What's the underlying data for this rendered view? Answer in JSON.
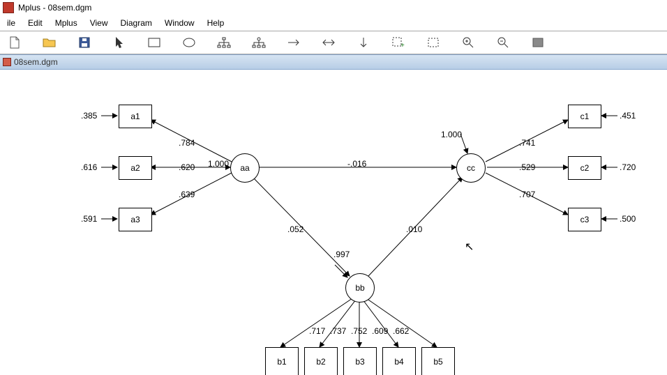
{
  "window": {
    "title": "Mplus - 08sem.dgm"
  },
  "menu": {
    "file": "ile",
    "edit": "Edit",
    "mplus": "Mplus",
    "view": "View",
    "diagram": "Diagram",
    "window": "Window",
    "help": "Help"
  },
  "tab": {
    "label": "08sem.dgm"
  },
  "diagram": {
    "nodes": {
      "a1": "a1",
      "a2": "a2",
      "a3": "a3",
      "aa": "aa",
      "bb": "bb",
      "cc": "cc",
      "b1": "b1",
      "b2": "b2",
      "b3": "b3",
      "b4": "b4",
      "b5": "b5",
      "c1": "c1",
      "c2": "c2",
      "c3": "c3"
    },
    "residuals": {
      "a1": ".385",
      "a2": ".616",
      "a3": ".591",
      "c1": ".451",
      "c2": ".720",
      "c3": ".500"
    },
    "loadings": {
      "aa_a1": ".784",
      "aa_a2": ".620",
      "aa_a3": ".639",
      "bb_b1": ".717",
      "bb_b2": ".737",
      "bb_b3": ".752",
      "bb_b4": ".609",
      "bb_b5": ".662",
      "cc_c1": ".741",
      "cc_c2": ".529",
      "cc_c3": ".707"
    },
    "paths": {
      "aa_cc_direct": "-.016",
      "aa_bb": ".052",
      "bb_cc": ".010",
      "aa_fixed": "1.000",
      "bb_var": ".997",
      "cc_var": "1.000"
    }
  },
  "chart_data": {
    "type": "path-diagram",
    "latent": [
      "aa",
      "bb",
      "cc"
    ],
    "observed": [
      "a1",
      "a2",
      "a3",
      "b1",
      "b2",
      "b3",
      "b4",
      "b5",
      "c1",
      "c2",
      "c3"
    ],
    "loadings": [
      {
        "from": "aa",
        "to": "a1",
        "value": 0.784
      },
      {
        "from": "aa",
        "to": "a2",
        "value": 0.62
      },
      {
        "from": "aa",
        "to": "a3",
        "value": 0.639
      },
      {
        "from": "bb",
        "to": "b1",
        "value": 0.717
      },
      {
        "from": "bb",
        "to": "b2",
        "value": 0.737
      },
      {
        "from": "bb",
        "to": "b3",
        "value": 0.752
      },
      {
        "from": "bb",
        "to": "b4",
        "value": 0.609
      },
      {
        "from": "bb",
        "to": "b5",
        "value": 0.662
      },
      {
        "from": "cc",
        "to": "c1",
        "value": 0.741
      },
      {
        "from": "cc",
        "to": "c2",
        "value": 0.529
      },
      {
        "from": "cc",
        "to": "c3",
        "value": 0.707
      }
    ],
    "structural_paths": [
      {
        "from": "aa",
        "to": "cc",
        "value": -0.016
      },
      {
        "from": "aa",
        "to": "bb",
        "value": 0.052
      },
      {
        "from": "bb",
        "to": "cc",
        "value": 0.01
      }
    ],
    "residual_variances": {
      "a1": 0.385,
      "a2": 0.616,
      "a3": 0.591,
      "c1": 0.451,
      "c2": 0.72,
      "c3": 0.5,
      "bb": 0.997,
      "cc": 1.0
    },
    "fixed": {
      "aa_scale": 1.0
    }
  }
}
